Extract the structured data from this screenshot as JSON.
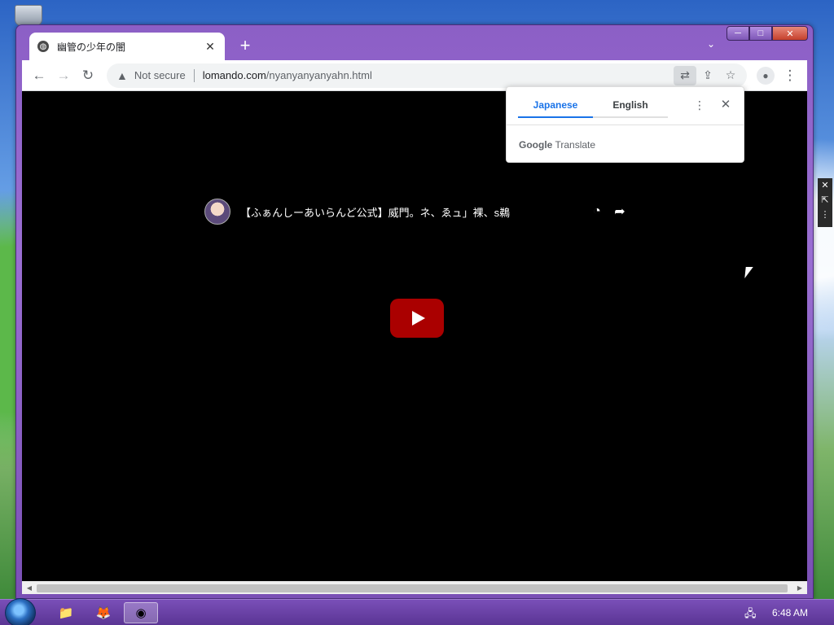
{
  "browser": {
    "tab": {
      "title": "幽管の少年の闇"
    },
    "toolbar": {
      "security_label": "Not secure",
      "url_host": "lomando.com",
      "url_path": "/nyanyanyanyahn.html"
    }
  },
  "translate_popup": {
    "source_language": "Japanese",
    "target_language": "English",
    "brand_google": "Google",
    "brand_translate": "Translate"
  },
  "video": {
    "title": "【ふぁんしーあいらんど公式】威門。ネ、ゑュ」裸、s鵜"
  },
  "taskbar": {
    "clock": "6:48 AM"
  },
  "icons": {
    "back": "arrow-left",
    "forward": "arrow-right",
    "reload": "reload",
    "warning": "warning-triangle",
    "translate": "translate",
    "share": "share",
    "bookmark": "star",
    "profile": "person",
    "menu": "vertical-dots",
    "watch_later": "clock",
    "share_video": "share-arrow"
  }
}
